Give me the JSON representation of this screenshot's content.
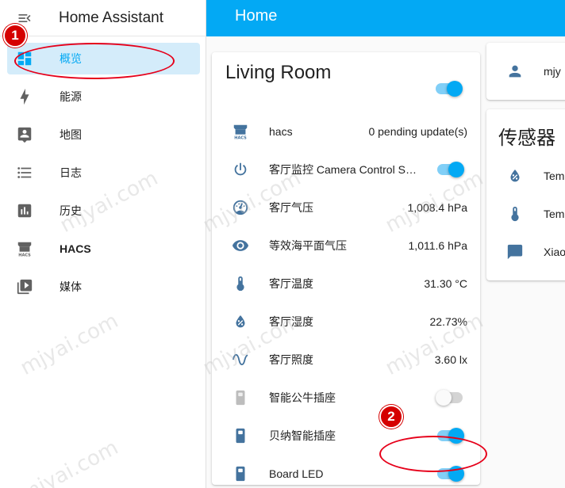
{
  "sidebar": {
    "title": "Home Assistant",
    "items": [
      {
        "label": "概览",
        "icon": "dashboard-icon"
      },
      {
        "label": "能源",
        "icon": "lightning-bolt-icon"
      },
      {
        "label": "地图",
        "icon": "map-account-icon"
      },
      {
        "label": "日志",
        "icon": "format-list-bulleted-icon"
      },
      {
        "label": "历史",
        "icon": "chart-box-icon"
      },
      {
        "label": "HACS",
        "icon": "hacs-store-icon"
      },
      {
        "label": "媒体",
        "icon": "play-box-multiple-icon"
      }
    ]
  },
  "topbar": {
    "title": "Home"
  },
  "living_room": {
    "title": "Living Room",
    "header_toggle_on": true,
    "rows": [
      {
        "name": "hacs",
        "value": "0 pending update(s)",
        "icon": "hacs-store-icon"
      },
      {
        "name": "客厅监控 Camera Control Swi...",
        "toggle": "on",
        "icon": "power-icon"
      },
      {
        "name": "客厅气压",
        "value": "1,008.4 hPa",
        "icon": "gauge-icon"
      },
      {
        "name": "等效海平面气压",
        "value": "1,011.6 hPa",
        "icon": "eye-icon"
      },
      {
        "name": "客厅温度",
        "value": "31.30 °C",
        "icon": "thermometer-icon"
      },
      {
        "name": "客厅湿度",
        "value": "22.73%",
        "icon": "water-percent-icon"
      },
      {
        "name": "客厅照度",
        "value": "3.60 lx",
        "icon": "sine-wave-icon"
      },
      {
        "name": "智能公牛插座",
        "toggle": "off",
        "icon": "power-socket-icon"
      },
      {
        "name": "贝纳智能插座",
        "toggle": "on",
        "icon": "power-socket-icon"
      },
      {
        "name": "Board LED",
        "toggle": "on",
        "icon": "power-socket-icon"
      }
    ]
  },
  "person_card": {
    "name": "mjy",
    "icon": "account-icon"
  },
  "sensor_card": {
    "title": "传感器",
    "rows": [
      {
        "name": "Tem",
        "icon": "water-percent-icon"
      },
      {
        "name": "Tem",
        "icon": "thermometer-icon"
      },
      {
        "name": "Xiao",
        "icon": "message-icon"
      }
    ]
  },
  "annotations": {
    "badge1": "1",
    "badge2": "2",
    "color": "#e6001a"
  },
  "watermark": "mjyai.com",
  "colors": {
    "accent": "#03a9f4",
    "icon": "#44739e",
    "active_bg": "#d4ecfa"
  }
}
